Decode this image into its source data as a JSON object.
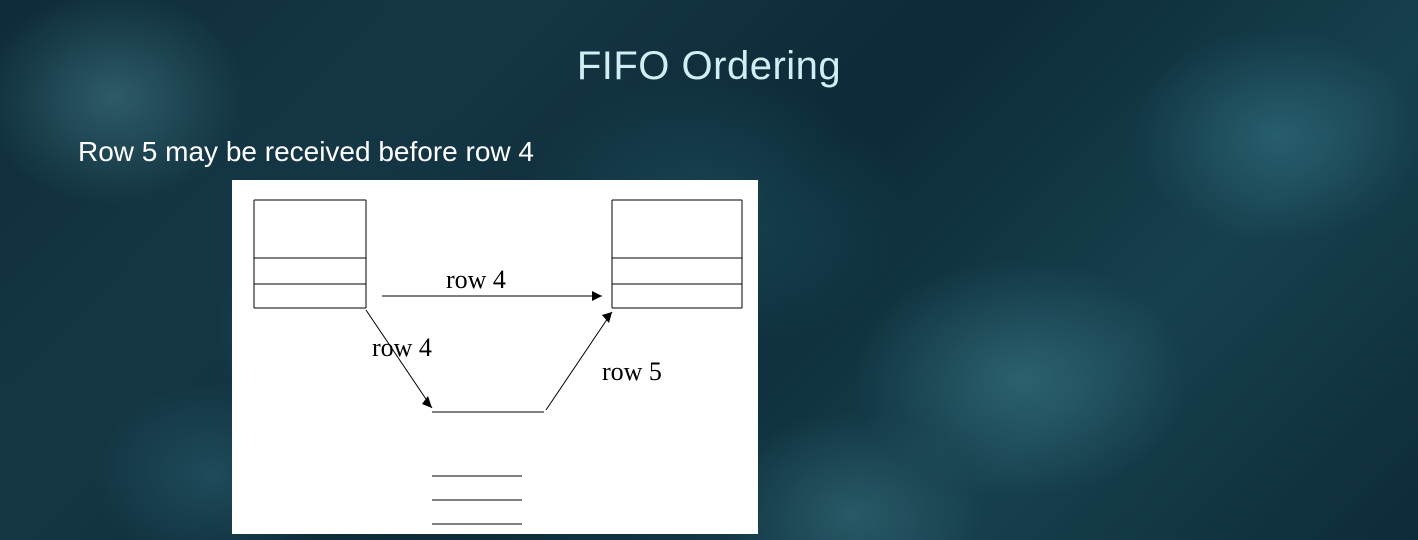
{
  "slide": {
    "title": "FIFO Ordering",
    "subtitle": "Row 5 may be received before row 4"
  },
  "diagram": {
    "labels": {
      "top_arrow": "row 4",
      "left_arrow": "row 4",
      "right_arrow": "row 5"
    }
  }
}
